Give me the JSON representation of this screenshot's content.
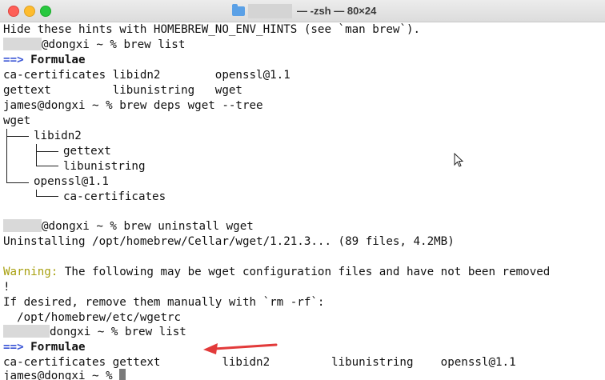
{
  "window": {
    "title_suffix": "— -zsh — 80×24",
    "icons": [
      "folder-icon"
    ],
    "colors": {
      "close": "#fe5f57",
      "minimize": "#febc2e",
      "maximize": "#28c840",
      "prompt_arrow": "#3b56d6",
      "warning": "#a8a010"
    }
  },
  "terminal": {
    "line1": "Hide these hints with HOMEBREW_NO_ENV_HINTS (see `man brew`).",
    "prompt1_suffix": "@dongxi ~ % brew list",
    "section_arrow": "==>",
    "formulae_label": " Formulae",
    "list_row1": "ca-certificates libidn2        openssl@1.1",
    "list_row2": "gettext         libunistring   wget",
    "prompt2_suffix": "james@dongxi ~ % brew deps wget --tree",
    "tree": {
      "root": "wget",
      "libidn2": "libidn2",
      "gettext": "gettext",
      "libunistring": "libunistring",
      "openssl": "openssl@1.1",
      "cacerts": "ca-certificates"
    },
    "prompt3_suffix": "@dongxi ~ % brew uninstall wget",
    "uninstall_line": "Uninstalling /opt/homebrew/Cellar/wget/1.21.3... (89 files, 4.2MB)",
    "warning_label": "Warning:",
    "warning_rest": " The following may be wget configuration files and have not been removed",
    "bang_line": "!",
    "ifdesired_line": "If desired, remove them manually with `rm -rf`:",
    "path_line": "  /opt/homebrew/etc/wgetrc",
    "prompt4_suffix": "dongxi ~ % brew list",
    "final_list_row": "ca-certificates gettext         libidn2         libunistring    openssl@1.1",
    "prompt5": "james@dongxi ~ % "
  }
}
